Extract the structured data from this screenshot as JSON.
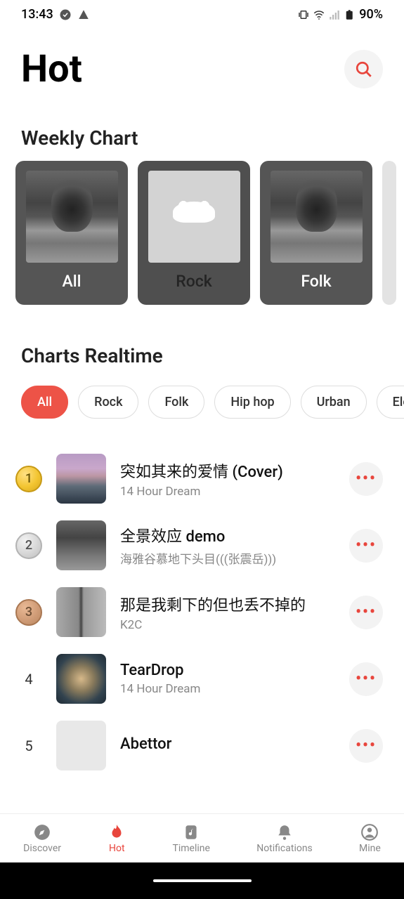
{
  "status": {
    "time": "13:43",
    "battery": "90%"
  },
  "header": {
    "title": "Hot"
  },
  "weekly": {
    "title": "Weekly Chart",
    "cards": [
      {
        "label": "All"
      },
      {
        "label": "Rock"
      },
      {
        "label": "Folk"
      }
    ]
  },
  "realtime": {
    "title": "Charts Realtime",
    "genres": [
      {
        "label": "All",
        "active": true
      },
      {
        "label": "Rock"
      },
      {
        "label": "Folk"
      },
      {
        "label": "Hip hop"
      },
      {
        "label": "Urban"
      },
      {
        "label": "Electron"
      }
    ],
    "songs": [
      {
        "rank": "1",
        "title": "突如其来的爱情 (Cover)",
        "artist": "14 Hour Dream"
      },
      {
        "rank": "2",
        "title": "全景效应 demo",
        "artist": "海雅谷慕地下头目(((张震岳)))"
      },
      {
        "rank": "3",
        "title": "那是我剩下的但也丢不掉的",
        "artist": "K2C"
      },
      {
        "rank": "4",
        "title": "TearDrop",
        "artist": "14 Hour Dream"
      },
      {
        "rank": "5",
        "title": "Abettor",
        "artist": ""
      }
    ]
  },
  "nav": {
    "items": [
      {
        "label": "Discover"
      },
      {
        "label": "Hot"
      },
      {
        "label": "Timeline"
      },
      {
        "label": "Notifications"
      },
      {
        "label": "Mine"
      }
    ]
  }
}
